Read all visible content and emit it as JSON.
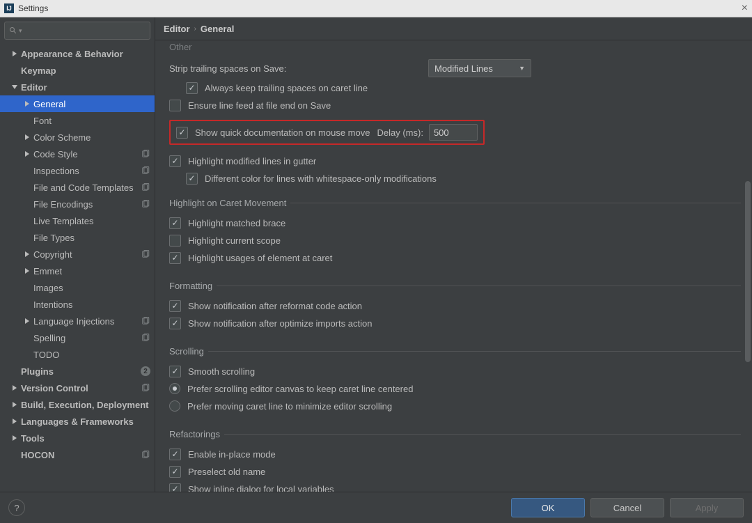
{
  "window": {
    "title": "Settings"
  },
  "sidebar": {
    "search_placeholder": "",
    "items": [
      {
        "label": "Appearance & Behavior",
        "lvl": 0,
        "arrow": "right",
        "bold": true
      },
      {
        "label": "Keymap",
        "lvl": 0,
        "arrow": "none",
        "bold": true
      },
      {
        "label": "Editor",
        "lvl": 0,
        "arrow": "down",
        "bold": true
      },
      {
        "label": "General",
        "lvl": 1,
        "arrow": "right",
        "selected": true
      },
      {
        "label": "Font",
        "lvl": 1,
        "arrow": "none"
      },
      {
        "label": "Color Scheme",
        "lvl": 1,
        "arrow": "right"
      },
      {
        "label": "Code Style",
        "lvl": 1,
        "arrow": "right",
        "copy": true
      },
      {
        "label": "Inspections",
        "lvl": 1,
        "arrow": "none",
        "copy": true
      },
      {
        "label": "File and Code Templates",
        "lvl": 1,
        "arrow": "none",
        "copy": true
      },
      {
        "label": "File Encodings",
        "lvl": 1,
        "arrow": "none",
        "copy": true
      },
      {
        "label": "Live Templates",
        "lvl": 1,
        "arrow": "none"
      },
      {
        "label": "File Types",
        "lvl": 1,
        "arrow": "none"
      },
      {
        "label": "Copyright",
        "lvl": 1,
        "arrow": "right",
        "copy": true
      },
      {
        "label": "Emmet",
        "lvl": 1,
        "arrow": "right"
      },
      {
        "label": "Images",
        "lvl": 1,
        "arrow": "none"
      },
      {
        "label": "Intentions",
        "lvl": 1,
        "arrow": "none"
      },
      {
        "label": "Language Injections",
        "lvl": 1,
        "arrow": "right",
        "copy": true
      },
      {
        "label": "Spelling",
        "lvl": 1,
        "arrow": "none",
        "copy": true
      },
      {
        "label": "TODO",
        "lvl": 1,
        "arrow": "none"
      },
      {
        "label": "Plugins",
        "lvl": 0,
        "arrow": "none",
        "bold": true,
        "count": "2"
      },
      {
        "label": "Version Control",
        "lvl": 0,
        "arrow": "right",
        "bold": true,
        "copy": true
      },
      {
        "label": "Build, Execution, Deployment",
        "lvl": 0,
        "arrow": "right",
        "bold": true
      },
      {
        "label": "Languages & Frameworks",
        "lvl": 0,
        "arrow": "right",
        "bold": true
      },
      {
        "label": "Tools",
        "lvl": 0,
        "arrow": "right",
        "bold": true
      },
      {
        "label": "HOCON",
        "lvl": 0,
        "arrow": "none",
        "bold": true,
        "copy": true
      }
    ]
  },
  "breadcrumb": {
    "a": "Editor",
    "b": "General"
  },
  "top_faded": "Other",
  "strip": {
    "label": "Strip trailing spaces on Save:",
    "selected": "Modified Lines",
    "always_keep": "Always keep trailing spaces on caret line",
    "ensure_lf": "Ensure line feed at file end on Save"
  },
  "docOnMove": {
    "label": "Show quick documentation on mouse move",
    "delay_label": "Delay (ms):",
    "delay_value": "500"
  },
  "gutter": {
    "highlight": "Highlight modified lines in gutter",
    "diffcolor": "Different color for lines with whitespace-only modifications"
  },
  "caret": {
    "legend": "Highlight on Caret Movement",
    "brace": "Highlight matched brace",
    "scope": "Highlight current scope",
    "usages": "Highlight usages of element at caret"
  },
  "formatting": {
    "legend": "Formatting",
    "reformat": "Show notification after reformat code action",
    "imports": "Show notification after optimize imports action"
  },
  "scrolling": {
    "legend": "Scrolling",
    "smooth": "Smooth scrolling",
    "centered": "Prefer scrolling editor canvas to keep caret line centered",
    "minimize": "Prefer moving caret line to minimize editor scrolling"
  },
  "refactor": {
    "legend": "Refactorings",
    "inplace": "Enable in-place mode",
    "preselect": "Preselect old name",
    "inline": "Show inline dialog for local variables"
  },
  "footer": {
    "ok": "OK",
    "cancel": "Cancel",
    "apply": "Apply"
  }
}
